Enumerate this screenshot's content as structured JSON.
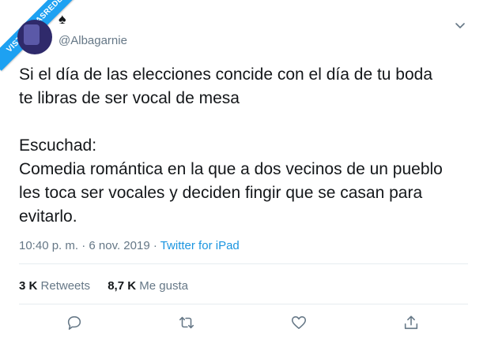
{
  "watermark": "VISTOENLASREDES",
  "user": {
    "display_icon": "♠",
    "handle": "@Albagarnie",
    "avatar": "avatar-image"
  },
  "tweet": {
    "line1": "Si el día de las elecciones concide con el día de tu boda",
    "line2": "te libras de ser vocal de mesa",
    "line3": "Escuchad:",
    "line4": "Comedia romántica en la que a dos vecinos de un pueblo",
    "line5": "les toca ser vocales y deciden fingir que se casan para",
    "line6": "evitarlo."
  },
  "meta": {
    "time_date": "10:40 p. m. · 6 nov. 2019 · ",
    "source": "Twitter for iPad"
  },
  "stats": {
    "retweets_count": "3 K",
    "retweets_label": "Retweets",
    "likes_count": "8,7 K",
    "likes_label": "Me gusta"
  },
  "icons": {
    "reply": "reply-icon",
    "retweet": "retweet-icon",
    "like": "heart-icon",
    "share": "share-icon",
    "menu": "chevron-down-icon"
  },
  "colors": {
    "link": "#1b95e0",
    "muted": "#657786",
    "text": "#14171a",
    "watermark": "#1da1f2"
  }
}
